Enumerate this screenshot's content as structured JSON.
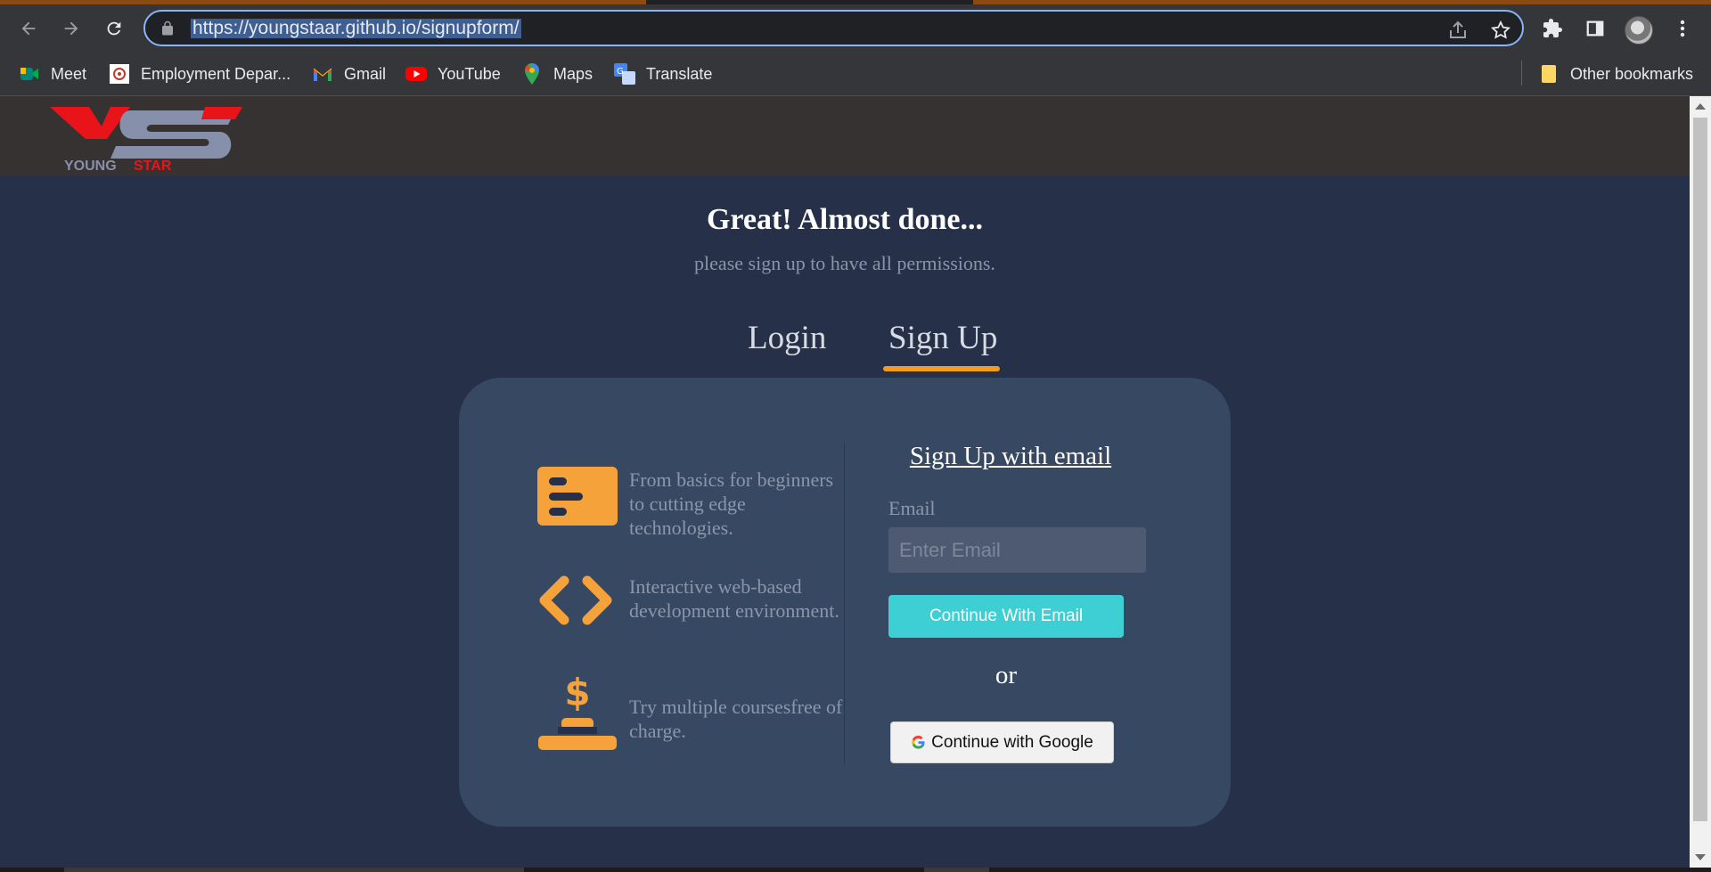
{
  "browser": {
    "url": "https://youngstaar.github.io/signupform/",
    "bookmarks": [
      {
        "label": "Meet",
        "icon": "meet-icon"
      },
      {
        "label": "Employment Depar...",
        "icon": "employment-icon"
      },
      {
        "label": "Gmail",
        "icon": "gmail-icon"
      },
      {
        "label": "YouTube",
        "icon": "youtube-icon"
      },
      {
        "label": "Maps",
        "icon": "maps-icon"
      },
      {
        "label": "Translate",
        "icon": "translate-icon"
      }
    ],
    "other_bookmarks": "Other bookmarks"
  },
  "site": {
    "logo_text_left": "YOUNG",
    "logo_text_right": "STAR",
    "headline": "Great! Almost done...",
    "subline": "please sign up to have all permissions.",
    "tabs": {
      "login": "Login",
      "signup": "Sign Up",
      "active": "signup"
    },
    "features": [
      {
        "icon": "card-icon",
        "text": "From basics for beginners to cutting edge technologies."
      },
      {
        "icon": "code-icon",
        "text": "Interactive web-based development environment."
      },
      {
        "icon": "dollar-icon",
        "text": "Try multiple coursesfree of charge."
      }
    ],
    "form": {
      "title": "Sign Up with email",
      "email_label": "Email",
      "email_placeholder": "Enter Email",
      "email_value": "",
      "continue_email": "Continue With Email",
      "or": "or",
      "continue_google": "Continue with Google"
    }
  },
  "colors": {
    "accent": "#f39a22",
    "teal_button": "#3ecfd4",
    "page_bg": "#263149",
    "card_bg": "#374862"
  }
}
